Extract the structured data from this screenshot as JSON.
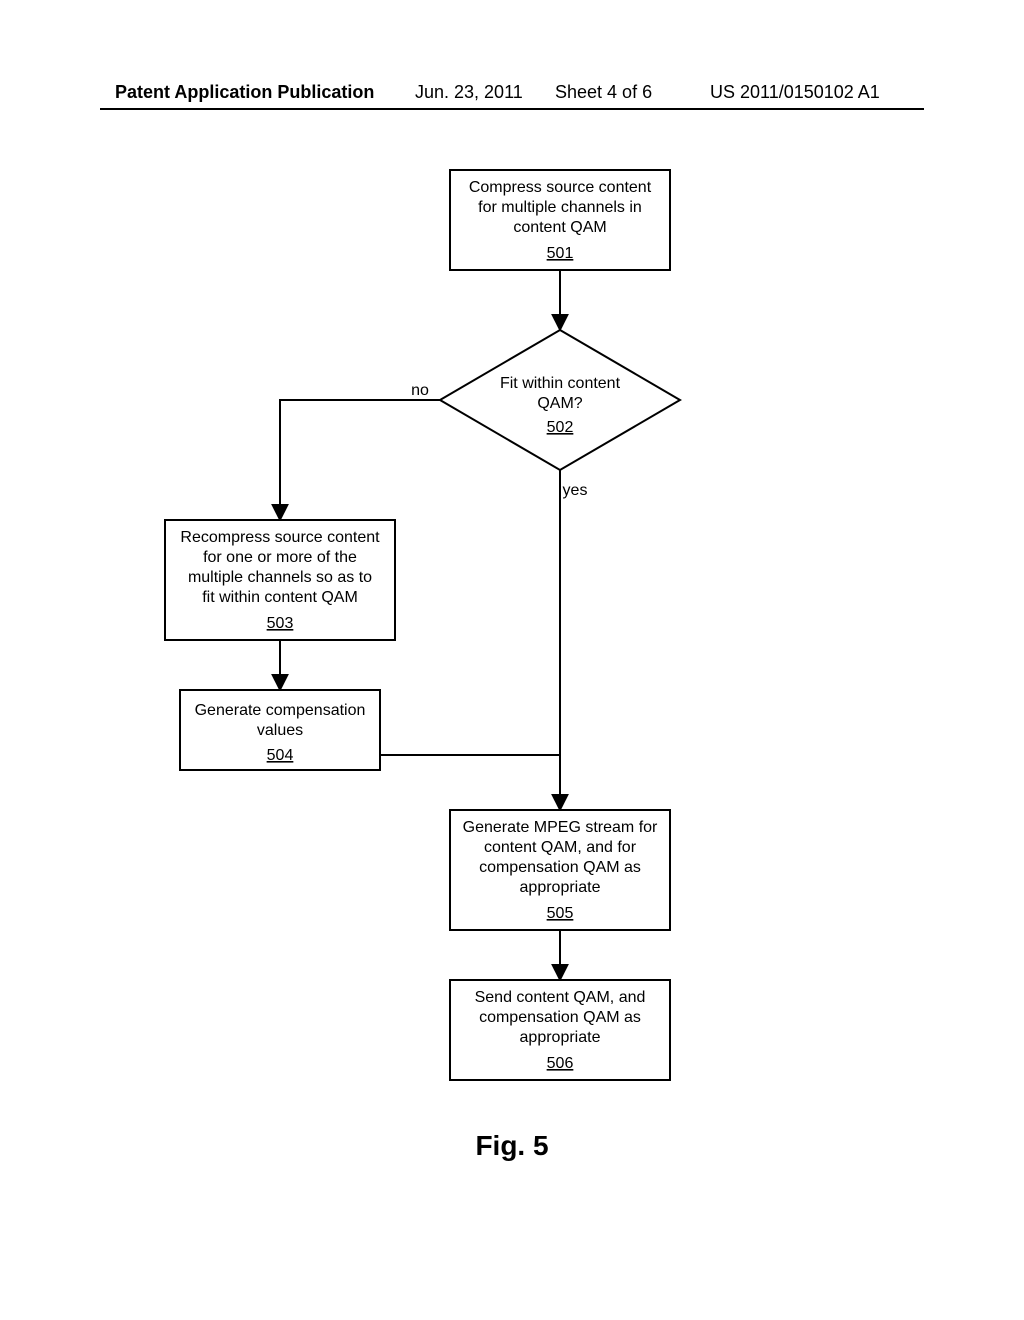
{
  "header": {
    "left": "Patent Application Publication",
    "date": "Jun. 23, 2011",
    "sheet": "Sheet 4 of 6",
    "pubno": "US 2011/0150102 A1"
  },
  "figure_label": "Fig. 5",
  "nodes": {
    "n501": {
      "l1": "Compress source content",
      "l2": "for multiple channels in",
      "l3": "content QAM",
      "ref": "501"
    },
    "n502": {
      "l1": "Fit within content",
      "l2": "QAM?",
      "ref": "502",
      "no": "no",
      "yes": "yes"
    },
    "n503": {
      "l1": "Recompress source content",
      "l2": "for one or more of the",
      "l3": "multiple channels so as to",
      "l4": "fit within content QAM",
      "ref": "503"
    },
    "n504": {
      "l1": "Generate compensation",
      "l2": "values",
      "ref": "504"
    },
    "n505": {
      "l1": "Generate MPEG stream for",
      "l2": "content QAM, and for",
      "l3": "compensation QAM as",
      "l4": "appropriate",
      "ref": "505"
    },
    "n506": {
      "l1": "Send content QAM, and",
      "l2": "compensation QAM as",
      "l3": "appropriate",
      "ref": "506"
    }
  },
  "chart_data": {
    "type": "flowchart",
    "title": "Fig. 5",
    "nodes": [
      {
        "id": "501",
        "shape": "process",
        "text": "Compress source content for multiple channels in content QAM"
      },
      {
        "id": "502",
        "shape": "decision",
        "text": "Fit within content QAM?"
      },
      {
        "id": "503",
        "shape": "process",
        "text": "Recompress source content for one or more of the multiple channels so as to fit within content QAM"
      },
      {
        "id": "504",
        "shape": "process",
        "text": "Generate compensation values"
      },
      {
        "id": "505",
        "shape": "process",
        "text": "Generate MPEG stream for content QAM, and for compensation QAM as appropriate"
      },
      {
        "id": "506",
        "shape": "process",
        "text": "Send content QAM, and compensation QAM as appropriate"
      }
    ],
    "edges": [
      {
        "from": "501",
        "to": "502",
        "label": ""
      },
      {
        "from": "502",
        "to": "503",
        "label": "no"
      },
      {
        "from": "502",
        "to": "505",
        "label": "yes"
      },
      {
        "from": "503",
        "to": "504",
        "label": ""
      },
      {
        "from": "504",
        "to": "505",
        "label": ""
      },
      {
        "from": "505",
        "to": "506",
        "label": ""
      }
    ]
  }
}
